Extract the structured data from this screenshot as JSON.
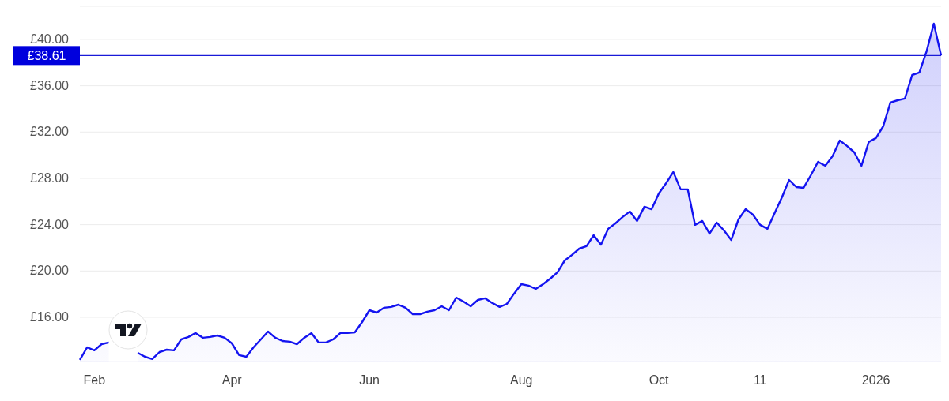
{
  "chart_data": {
    "type": "area",
    "grid": true,
    "ylim": [
      12.18,
      42.86
    ],
    "yticks": [
      {
        "value": 16,
        "label": "£16.00"
      },
      {
        "value": 20,
        "label": "£20.00"
      },
      {
        "value": 24,
        "label": "£24.00"
      },
      {
        "value": 28,
        "label": "£28.00"
      },
      {
        "value": 32,
        "label": "£32.00"
      },
      {
        "value": 36,
        "label": "£36.00"
      },
      {
        "value": 40,
        "label": "£40.00"
      }
    ],
    "categories": [
      null,
      null,
      "Feb",
      null,
      null,
      null,
      null,
      null,
      null,
      null,
      null,
      null,
      null,
      null,
      null,
      null,
      null,
      null,
      null,
      null,
      null,
      "Apr",
      null,
      null,
      null,
      null,
      null,
      null,
      null,
      null,
      null,
      null,
      null,
      null,
      null,
      null,
      null,
      null,
      null,
      null,
      "Jun",
      null,
      null,
      null,
      null,
      null,
      null,
      null,
      null,
      null,
      null,
      null,
      null,
      null,
      null,
      null,
      null,
      null,
      null,
      null,
      null,
      "Aug",
      null,
      null,
      null,
      null,
      null,
      null,
      null,
      null,
      null,
      null,
      null,
      null,
      null,
      null,
      null,
      null,
      null,
      null,
      "Oct",
      null,
      null,
      null,
      null,
      null,
      null,
      null,
      null,
      null,
      null,
      null,
      null,
      null,
      "11",
      null,
      null,
      null,
      null,
      null,
      null,
      null,
      null,
      null,
      null,
      null,
      null,
      null,
      null,
      null,
      "2026",
      null,
      null,
      null,
      null,
      null,
      null,
      null,
      null,
      null
    ],
    "series": [
      {
        "color": "#1414f0",
        "values": [
          12.32,
          13.41,
          13.14,
          13.68,
          13.82,
          null,
          null,
          null,
          12.93,
          12.59,
          12.39,
          13.0,
          13.2,
          13.14,
          14.09,
          14.3,
          14.64,
          14.23,
          14.3,
          14.43,
          14.23,
          13.75,
          12.73,
          12.59,
          13.41,
          14.09,
          14.77,
          14.23,
          13.95,
          13.89,
          13.68,
          14.23,
          14.64,
          13.82,
          13.82,
          14.09,
          14.64,
          14.64,
          14.7,
          15.59,
          16.61,
          16.41,
          16.82,
          16.89,
          17.09,
          16.82,
          16.27,
          16.27,
          16.48,
          16.61,
          16.95,
          16.61,
          17.7,
          17.36,
          16.95,
          17.5,
          17.64,
          17.23,
          16.89,
          17.16,
          18.05,
          18.86,
          18.73,
          18.45,
          18.86,
          19.34,
          19.89,
          20.91,
          21.39,
          21.93,
          22.14,
          23.09,
          22.27,
          23.64,
          24.11,
          24.66,
          25.14,
          24.32,
          25.55,
          25.34,
          26.7,
          27.59,
          28.55,
          27.05,
          27.05,
          23.98,
          24.32,
          23.23,
          24.18,
          23.5,
          22.68,
          24.45,
          25.34,
          24.86,
          23.98,
          23.64,
          25.0,
          26.36,
          27.86,
          27.25,
          27.18,
          28.27,
          29.43,
          29.09,
          29.91,
          31.27,
          30.8,
          30.25,
          29.09,
          31.14,
          31.48,
          32.5,
          34.55,
          34.75,
          34.89,
          36.93,
          37.14,
          38.98,
          41.36,
          38.61
        ]
      }
    ],
    "ref_lines": [
      {
        "axis": "y",
        "value": 38.61,
        "label": "£38.61"
      }
    ]
  }
}
